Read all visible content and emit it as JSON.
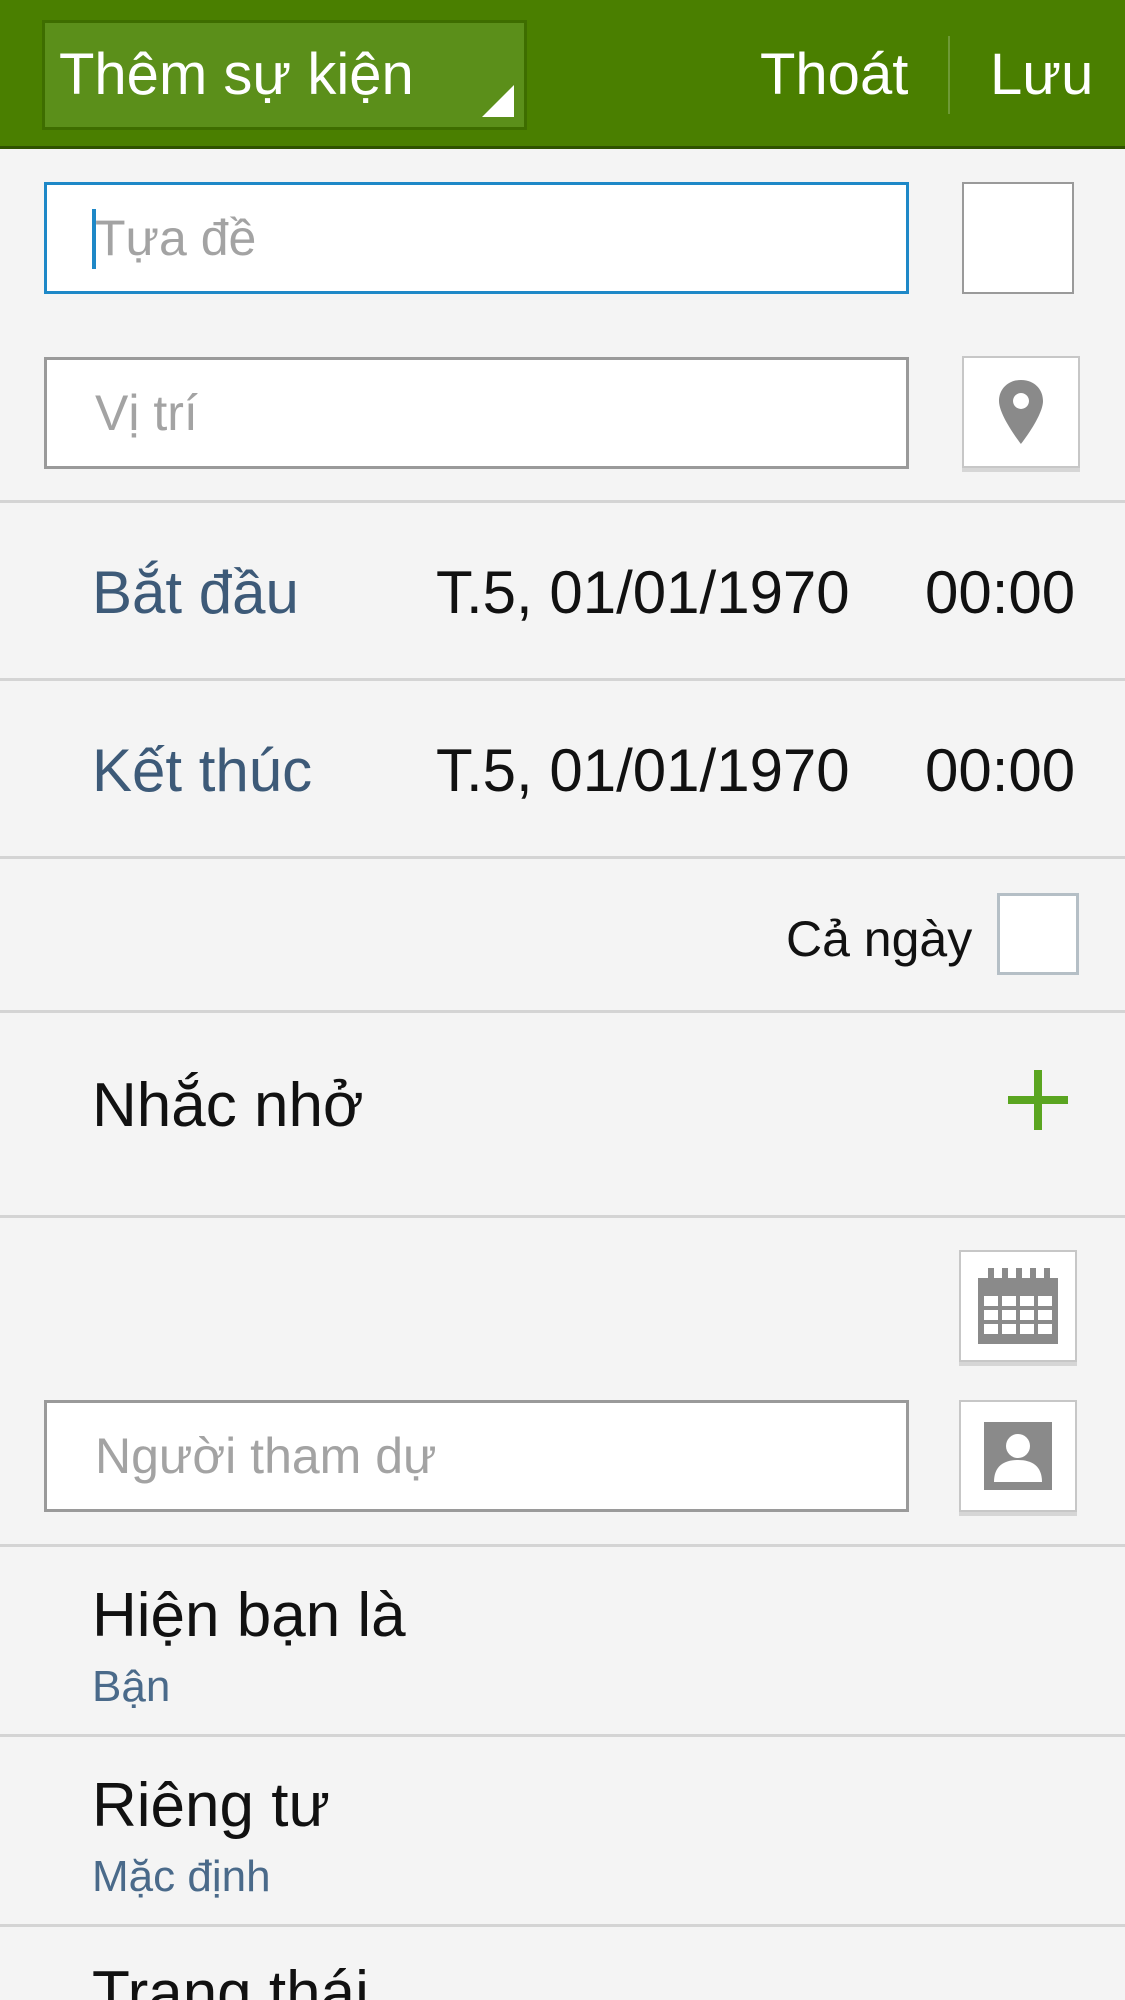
{
  "header": {
    "title": "Thêm sự kiện",
    "exit_label": "Thoát",
    "save_label": "Lưu"
  },
  "title_field": {
    "placeholder": "Tựa đề"
  },
  "location_field": {
    "placeholder": "Vị trí"
  },
  "start": {
    "label": "Bắt đầu",
    "date": "T.5, 01/01/1970",
    "time": "00:00"
  },
  "end": {
    "label": "Kết thúc",
    "date": "T.5, 01/01/1970",
    "time": "00:00"
  },
  "all_day": {
    "label": "Cả ngày",
    "checked": false
  },
  "reminder": {
    "label": "Nhắc nhở"
  },
  "attendees_field": {
    "placeholder": "Người tham dự"
  },
  "show_as": {
    "label": "Hiện bạn là",
    "value": "Bận"
  },
  "privacy": {
    "label": "Riêng tư",
    "value": "Mặc định"
  },
  "status": {
    "label": "Trạng thái"
  },
  "icons": {
    "location": "map-pin-icon",
    "calendar": "calendar-icon",
    "contact": "contact-icon",
    "add": "plus-icon"
  },
  "colors": {
    "appbar": "#4a7f00",
    "focus": "#1e88c7",
    "accent_plus": "#5aa520"
  }
}
